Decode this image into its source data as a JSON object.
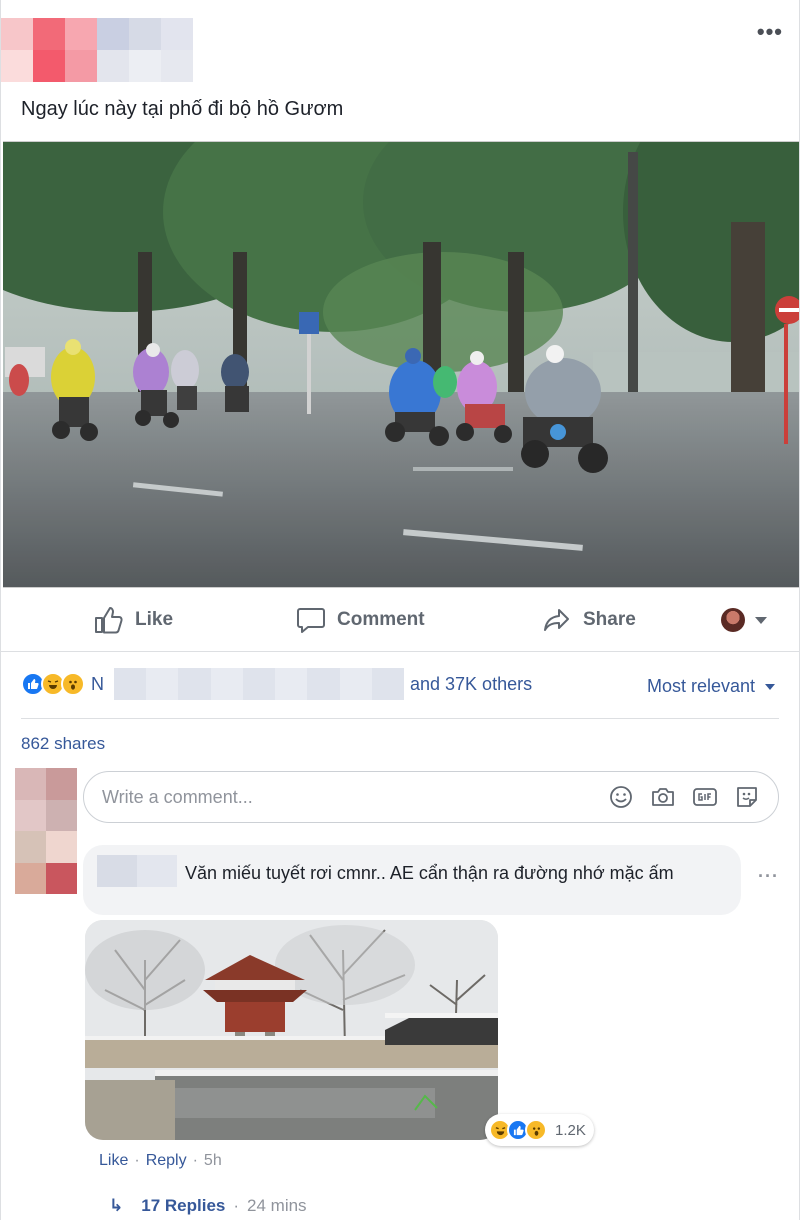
{
  "post": {
    "text": "Ngay lúc này tại phố đi bộ hồ Gươm",
    "more_icon": "more-dots-icon"
  },
  "actions": {
    "like": "Like",
    "comment": "Comment",
    "share": "Share"
  },
  "reactions_summary": {
    "icons": [
      "like",
      "haha",
      "wow"
    ],
    "prefix": "N",
    "others": "and 37K others",
    "sort_label": "Most relevant"
  },
  "shares": "862 shares",
  "comment_input": {
    "placeholder": "Write a comment..."
  },
  "comment": {
    "text": "Văn miếu tuyết rơi cmnr.. AE cẩn thận ra đường nhớ mặc ấm",
    "reaction_count": "1.2K",
    "like": "Like",
    "dot": "·",
    "reply": "Reply",
    "time": "5h",
    "replies": "17 Replies",
    "replies_time": "24 mins"
  },
  "colors": {
    "link": "#365899",
    "like_blue": "#1877f2",
    "emoji_yellow": "#f7b928",
    "muted": "#90949c"
  }
}
